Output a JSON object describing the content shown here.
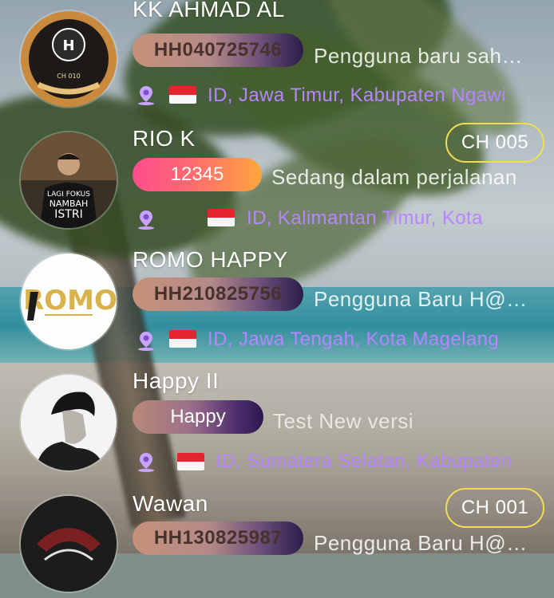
{
  "rows": [
    {
      "name": "KK AHMAD AL",
      "user_id": "HH040725746",
      "status": "Pengguna baru sah…",
      "location": "ID, Jawa Timur, Kabupaten Ngawi",
      "channel": "",
      "avatar": "ch010-logo-avatar"
    },
    {
      "name": "RIO K",
      "user_id": "12345",
      "status": "Sedang dalam perjalanan",
      "location": "ID, Kalimantan Timur, Kota",
      "channel": "CH 005",
      "avatar": "photo-avatar",
      "avatar_text": [
        "LAGI FOKUS",
        "NAMBAH",
        "ISTRI"
      ]
    },
    {
      "name": "ROMO HAPPY",
      "user_id": "HH210825756",
      "status": "Pengguna Baru H@…",
      "location": "ID, Jawa Tengah, Kota Magelang",
      "channel": "",
      "avatar": "romo-logo-avatar",
      "avatar_text": "ROMO"
    },
    {
      "name": "Happy II",
      "user_id": "Happy",
      "status": "Test New versi",
      "location": "ID, Sumatera Selatan, Kabupaten",
      "channel": "",
      "avatar": "photo-avatar"
    },
    {
      "name": "Wawan",
      "user_id": "HH130825987",
      "status": "Pengguna Baru H@…",
      "location": "",
      "channel": "CH 001",
      "avatar": "logo-avatar"
    }
  ],
  "colors": {
    "location_text": "#b685ff",
    "channel_border": "#f3dc52",
    "flag_red": "#e3262e"
  },
  "icons": [
    "location-pin-icon",
    "indonesia-flag-icon"
  ],
  "ch010_badge_text": "CH 010"
}
